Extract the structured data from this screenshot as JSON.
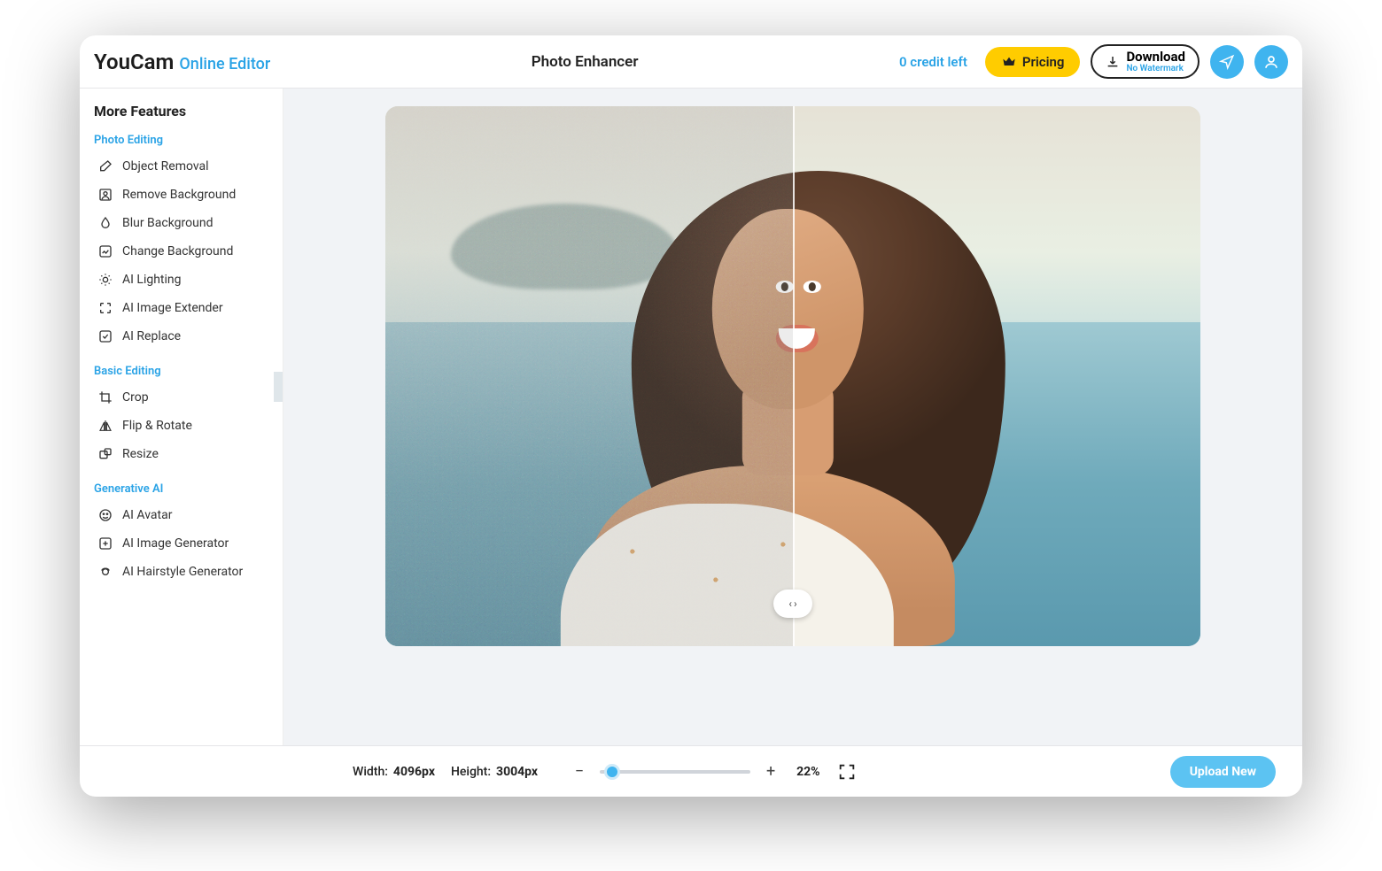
{
  "header": {
    "logo_main": "YouCam",
    "logo_sub": "Online Editor",
    "title": "Photo Enhancer",
    "credit_text": "0 credit left",
    "pricing_label": "Pricing",
    "download_label": "Download",
    "download_sub": "No Watermark"
  },
  "sidebar": {
    "title": "More Features",
    "sections": [
      {
        "heading": "Photo Editing",
        "items": [
          {
            "icon": "eraser-icon",
            "label": "Object Removal"
          },
          {
            "icon": "cutout-icon",
            "label": "Remove Background"
          },
          {
            "icon": "droplet-icon",
            "label": "Blur Background"
          },
          {
            "icon": "swap-icon",
            "label": "Change Background"
          },
          {
            "icon": "sun-icon",
            "label": "AI Lighting"
          },
          {
            "icon": "expand-icon",
            "label": "AI Image Extender"
          },
          {
            "icon": "replace-icon",
            "label": "AI Replace"
          }
        ]
      },
      {
        "heading": "Basic Editing",
        "items": [
          {
            "icon": "crop-icon",
            "label": "Crop"
          },
          {
            "icon": "flip-icon",
            "label": "Flip & Rotate"
          },
          {
            "icon": "resize-icon",
            "label": "Resize"
          }
        ]
      },
      {
        "heading": "Generative AI",
        "items": [
          {
            "icon": "avatar-icon",
            "label": "AI Avatar"
          },
          {
            "icon": "gen-icon",
            "label": "AI Image Generator"
          },
          {
            "icon": "hair-icon",
            "label": "AI Hairstyle Generator"
          }
        ]
      }
    ]
  },
  "footer": {
    "width_label": "Width:",
    "width_value": "4096px",
    "height_label": "Height:",
    "height_value": "3004px",
    "zoom_value": "22%",
    "upload_label": "Upload New"
  }
}
